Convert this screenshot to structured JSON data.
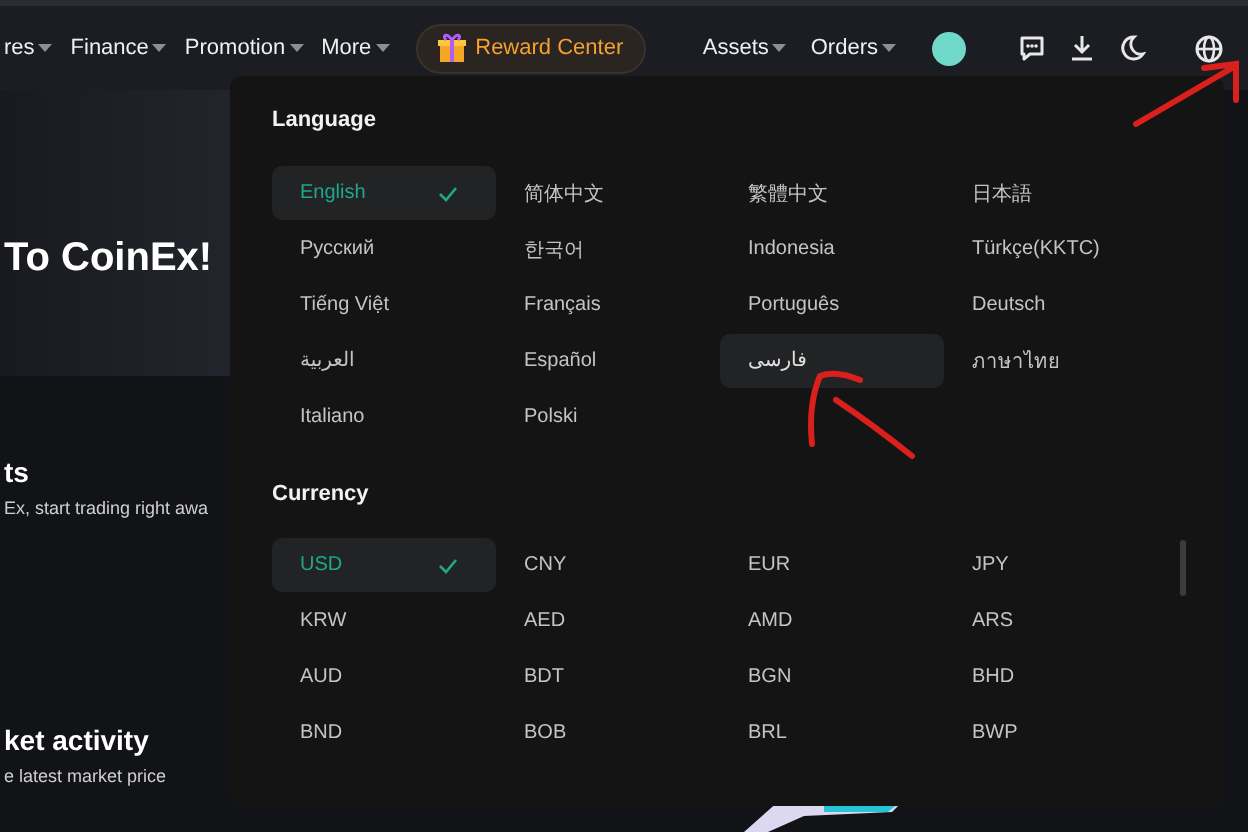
{
  "nav": {
    "items": [
      {
        "label": "res",
        "dropdown": true
      },
      {
        "label": "Finance",
        "dropdown": true
      },
      {
        "label": "Promotion",
        "dropdown": true
      },
      {
        "label": "More",
        "dropdown": true
      }
    ],
    "reward_button": "Reward Center",
    "right_items": [
      {
        "label": "Assets",
        "dropdown": true
      },
      {
        "label": "Orders",
        "dropdown": true
      }
    ]
  },
  "background": {
    "hero_title": "To CoinEx!",
    "section_1_title": "ts",
    "section_1_text": "Ex, start trading right awa",
    "section_2_title": "ket activity",
    "section_2_text": "e latest market price"
  },
  "language_menu": {
    "language_heading": "Language",
    "languages": [
      {
        "label": "English",
        "selected": true,
        "hovered": false
      },
      {
        "label": "简体中文",
        "selected": false,
        "hovered": false
      },
      {
        "label": "繁體中文",
        "selected": false,
        "hovered": false
      },
      {
        "label": "日本語",
        "selected": false,
        "hovered": false
      },
      {
        "label": "Русский",
        "selected": false,
        "hovered": false
      },
      {
        "label": "한국어",
        "selected": false,
        "hovered": false
      },
      {
        "label": "Indonesia",
        "selected": false,
        "hovered": false
      },
      {
        "label": "Türkçe(KKTC)",
        "selected": false,
        "hovered": false
      },
      {
        "label": "Tiếng Việt",
        "selected": false,
        "hovered": false
      },
      {
        "label": "Français",
        "selected": false,
        "hovered": false
      },
      {
        "label": "Português",
        "selected": false,
        "hovered": false
      },
      {
        "label": "Deutsch",
        "selected": false,
        "hovered": false
      },
      {
        "label": "العربية",
        "selected": false,
        "hovered": false
      },
      {
        "label": "Español",
        "selected": false,
        "hovered": false
      },
      {
        "label": "فارسی",
        "selected": false,
        "hovered": true
      },
      {
        "label": "ภาษาไทย",
        "selected": false,
        "hovered": false
      },
      {
        "label": "Italiano",
        "selected": false,
        "hovered": false
      },
      {
        "label": "Polski",
        "selected": false,
        "hovered": false
      }
    ],
    "currency_heading": "Currency",
    "currencies": [
      {
        "label": "USD",
        "selected": true
      },
      {
        "label": "CNY",
        "selected": false
      },
      {
        "label": "EUR",
        "selected": false
      },
      {
        "label": "JPY",
        "selected": false
      },
      {
        "label": "KRW",
        "selected": false
      },
      {
        "label": "AED",
        "selected": false
      },
      {
        "label": "AMD",
        "selected": false
      },
      {
        "label": "ARS",
        "selected": false
      },
      {
        "label": "AUD",
        "selected": false
      },
      {
        "label": "BDT",
        "selected": false
      },
      {
        "label": "BGN",
        "selected": false
      },
      {
        "label": "BHD",
        "selected": false
      },
      {
        "label": "BND",
        "selected": false
      },
      {
        "label": "BOB",
        "selected": false
      },
      {
        "label": "BRL",
        "selected": false
      },
      {
        "label": "BWP",
        "selected": false
      }
    ]
  }
}
